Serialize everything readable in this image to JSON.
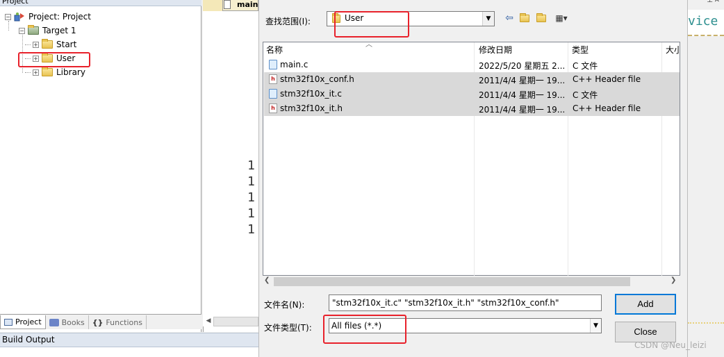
{
  "project_panel": {
    "title": "Project",
    "tree": [
      {
        "label": "Project: Project",
        "expander": "−",
        "level": 0
      },
      {
        "label": "Target 1",
        "expander": "−",
        "level": 1
      },
      {
        "label": "Start",
        "expander": "+",
        "level": 2
      },
      {
        "label": "User",
        "expander": "+",
        "level": 2
      },
      {
        "label": "Library",
        "expander": "+",
        "level": 2
      }
    ],
    "tabs": [
      {
        "label": "Project"
      },
      {
        "label": "Books"
      },
      {
        "label": "Functions"
      }
    ]
  },
  "build_output": {
    "title": "Build Output"
  },
  "editor": {
    "tab_label": "main.c",
    "line_numbers": [
      "1",
      "1",
      "1",
      "1",
      "1"
    ],
    "right_code": "vice"
  },
  "dialog": {
    "look_in_label": "查找范围(I):",
    "look_in_value": "User",
    "columns": [
      "名称",
      "修改日期",
      "类型",
      "大小"
    ],
    "files": [
      {
        "name": "main.c",
        "date": "2022/5/20 星期五 2...",
        "type": "C 文件",
        "icon": "c-file-icon",
        "selected": false
      },
      {
        "name": "stm32f10x_conf.h",
        "date": "2011/4/4 星期一 19...",
        "type": "C++ Header file",
        "icon": "h-file-icon",
        "selected": true
      },
      {
        "name": "stm32f10x_it.c",
        "date": "2011/4/4 星期一 19...",
        "type": "C 文件",
        "icon": "c-file-icon",
        "selected": true
      },
      {
        "name": "stm32f10x_it.h",
        "date": "2011/4/4 星期一 19...",
        "type": "C++ Header file",
        "icon": "h-file-icon",
        "selected": true
      }
    ],
    "filename_label": "文件名(N):",
    "filename_value": "\"stm32f10x_it.c\" \"stm32f10x_it.h\" \"stm32f10x_conf.h\"",
    "filetype_label": "文件类型(T):",
    "filetype_value": "All files (*.*)",
    "add_label": "Add",
    "close_label": "Close"
  },
  "watermark": "CSDN @Neu_leizi",
  "colors": {
    "highlight_box": "#e8212b",
    "selection": "#d9d9d9",
    "focus_border": "#0078d7"
  }
}
